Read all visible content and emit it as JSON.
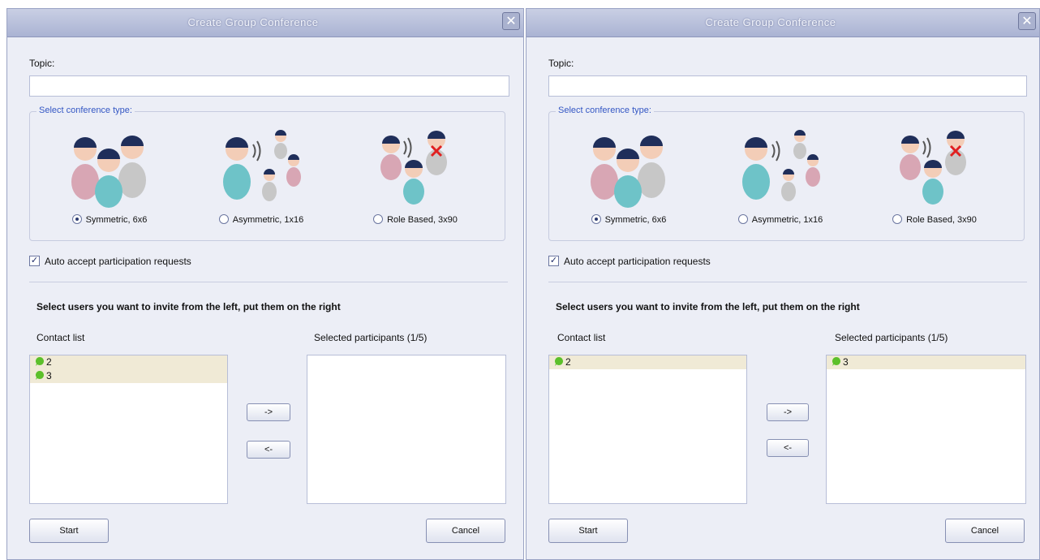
{
  "dialogs": [
    {
      "title": "Create Group Conference",
      "close_glyph": "✕",
      "topic_label": "Topic:",
      "topic_value": "",
      "conference_type_legend": "Select conference type:",
      "conference_types": [
        {
          "label": "Symmetric, 6x6",
          "selected": true,
          "icon": "symmetric-conference-icon"
        },
        {
          "label": "Asymmetric, 1x16",
          "selected": false,
          "icon": "asymmetric-conference-icon"
        },
        {
          "label": "Role Based, 3x90",
          "selected": false,
          "icon": "role-based-conference-icon"
        }
      ],
      "auto_accept_label": "Auto accept participation requests",
      "auto_accept_checked": true,
      "instruction": "Select users you want to invite from the left, put them on the right",
      "contact_list_label": "Contact list",
      "contacts": [
        "2",
        "3"
      ],
      "selected_label": "Selected participants (1/5)",
      "selected": [],
      "add_button": "->",
      "remove_button": "<-",
      "start_button": "Start",
      "cancel_button": "Cancel"
    },
    {
      "title": "Create Group Conference",
      "close_glyph": "✕",
      "topic_label": "Topic:",
      "topic_value": "",
      "conference_type_legend": "Select conference type:",
      "conference_types": [
        {
          "label": "Symmetric, 6x6",
          "selected": true,
          "icon": "symmetric-conference-icon"
        },
        {
          "label": "Asymmetric, 1x16",
          "selected": false,
          "icon": "asymmetric-conference-icon"
        },
        {
          "label": "Role Based, 3x90",
          "selected": false,
          "icon": "role-based-conference-icon"
        }
      ],
      "auto_accept_label": "Auto accept participation requests",
      "auto_accept_checked": true,
      "instruction": "Select users you want to invite from the left, put them on the right",
      "contact_list_label": "Contact list",
      "contacts": [
        "2"
      ],
      "selected_label": "Selected participants (1/5)",
      "selected": [
        "3"
      ],
      "add_button": "->",
      "remove_button": "<-",
      "start_button": "Start",
      "cancel_button": "Cancel"
    }
  ],
  "colors": {
    "dialog_bg": "#eceef6",
    "legend_text": "#3457c4",
    "list_item_bg": "#f0ead6",
    "contact_status": "#5cc02a"
  }
}
